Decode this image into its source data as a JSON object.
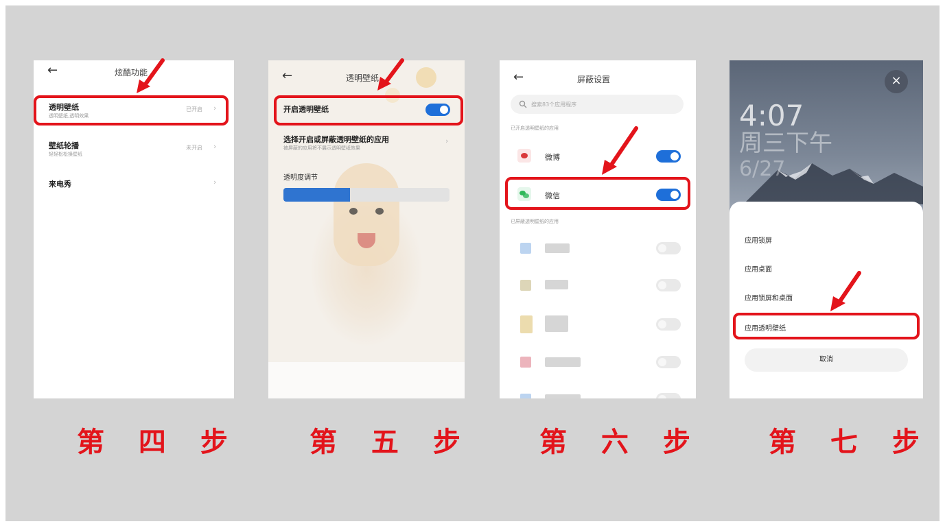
{
  "steps": {
    "step4": "第 四 步",
    "step5": "第 五 步",
    "step6": "第 六 步",
    "step7": "第 七 步"
  },
  "screen4": {
    "back": "←",
    "title": "炫酷功能",
    "rows": [
      {
        "title": "透明壁纸",
        "sub": "透明壁纸,透明效果",
        "status": "已开启",
        "chev": "›"
      },
      {
        "title": "壁纸轮播",
        "sub": "轻轻松松换壁纸",
        "status": "未开启",
        "chev": "›"
      },
      {
        "title": "来电秀",
        "sub": "",
        "status": "",
        "chev": "›"
      }
    ]
  },
  "screen5": {
    "back": "←",
    "title": "透明壁纸",
    "enable_label": "开启透明壁纸",
    "enable_on": true,
    "select_title": "选择开启或屏蔽透明壁纸的应用",
    "select_sub": "被屏蔽的应用将不展示透明壁纸效果",
    "chev": "›",
    "opacity_label": "透明度调节",
    "opacity_value": 0.4
  },
  "screen6": {
    "back": "←",
    "title": "屏蔽设置",
    "search_placeholder": "搜索83个应用程序",
    "section_enabled": "已开启透明壁纸的应用",
    "apps_enabled": [
      {
        "name": "微博",
        "on": true
      },
      {
        "name": "微信",
        "on": true
      }
    ],
    "section_blocked": "已屏蔽透明壁纸的应用"
  },
  "screen7": {
    "close": "×",
    "time": "4:07",
    "date": "周三下午",
    "date2": "6/27",
    "menu": [
      "应用锁屏",
      "应用桌面",
      "应用锁屏和桌面",
      "应用透明壁纸"
    ],
    "cancel": "取消"
  },
  "colors": {
    "red": "#e3141b",
    "blue": "#1e6fd9",
    "board": "#d4d4d4"
  }
}
